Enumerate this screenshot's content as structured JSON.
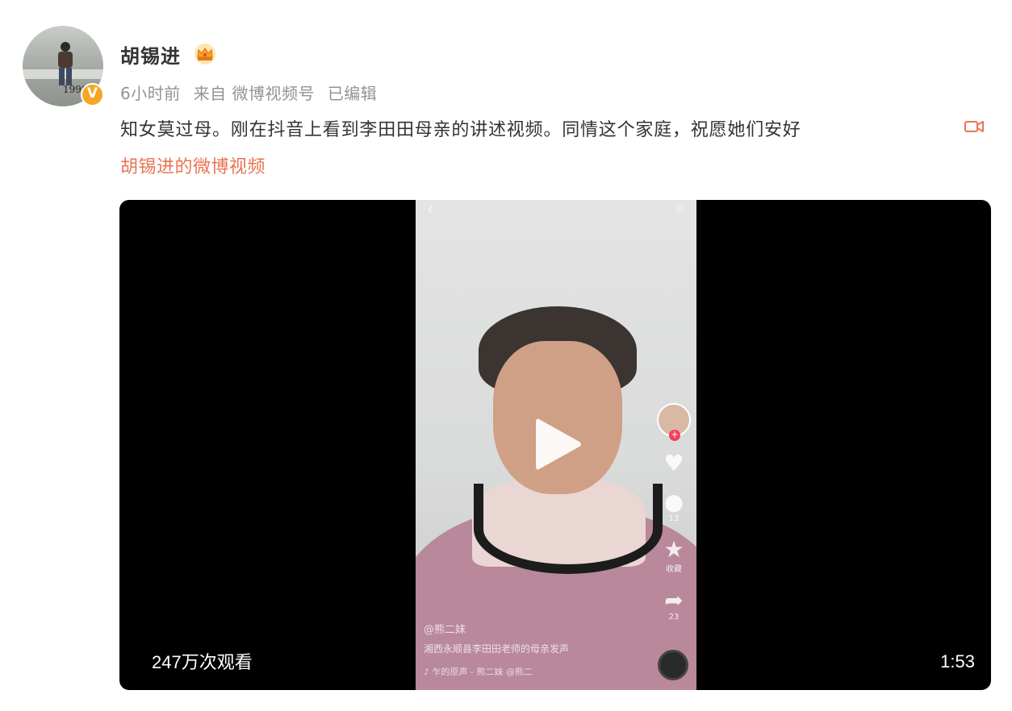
{
  "post": {
    "username": "胡锡进",
    "time": "6小时前",
    "source": "来自 微博视频号",
    "edited": "已编辑",
    "text": "知女莫过母。刚在抖音上看到李田田母亲的讲述视频。同情这个家庭，祝愿她们安好",
    "video_link": "胡锡进的微博视频",
    "verified_mark": "V",
    "avatar_caption": "1996",
    "icons": [
      "crown-icon",
      "verified-icon",
      "video-camera-icon",
      "play-icon"
    ]
  },
  "video": {
    "views": "247万次观看",
    "duration": "1:53",
    "overlay": {
      "user": "@熊二妹",
      "description": "湘西永顺县李田田老师的母亲发声",
      "music": "♪ 乍的原声 - 熊二妹  @熊二",
      "comments_count": "13",
      "favorite_label": "收藏",
      "share_count": "23"
    }
  },
  "colors": {
    "link": "#eb7350",
    "meta": "#939393",
    "text": "#333333",
    "badge": "#f5a623"
  }
}
